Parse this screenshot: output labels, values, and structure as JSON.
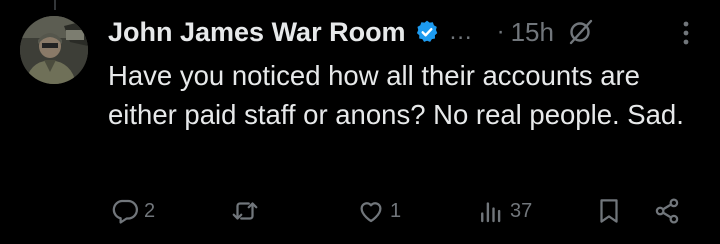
{
  "post": {
    "author_name": "John James War Room",
    "truncation": "...",
    "separator": "·",
    "time": "15h",
    "text": "Have you noticed how all their accounts are either paid staff or anons? No real people. Sad.",
    "verified_icon": "verified-badge-icon",
    "community_icon": "community-note-icon",
    "more_icon": "more-options-icon"
  },
  "actions": {
    "reply": {
      "icon": "reply-icon",
      "count": "2"
    },
    "repost": {
      "icon": "repost-icon",
      "count": ""
    },
    "like": {
      "icon": "like-icon",
      "count": "1"
    },
    "views": {
      "icon": "views-icon",
      "count": "37"
    },
    "bookmark": {
      "icon": "bookmark-icon"
    },
    "share": {
      "icon": "share-icon"
    }
  },
  "colors": {
    "background": "#000000",
    "text_primary": "#e7e9ea",
    "text_secondary": "#71767b",
    "verified_blue": "#1d9bf0",
    "thread_line": "#333639"
  }
}
